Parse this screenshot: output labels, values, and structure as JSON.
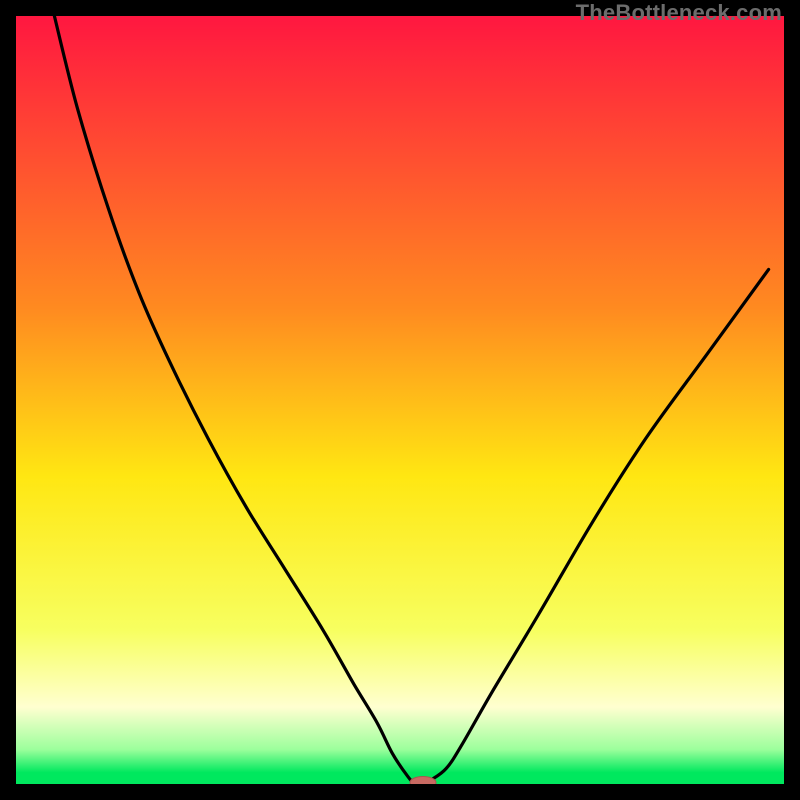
{
  "watermark": "TheBottleneck.com",
  "colors": {
    "top": "#ff1740",
    "mid_upper": "#ff8a20",
    "mid": "#ffe712",
    "mid_lower": "#f7ff60",
    "cream": "#ffffd0",
    "green_light": "#9cff9c",
    "green": "#00e85e",
    "curve": "#000000",
    "marker": "#c86a62",
    "frame": "#000000"
  },
  "chart_data": {
    "type": "line",
    "title": "",
    "xlabel": "",
    "ylabel": "",
    "xlim": [
      0,
      100
    ],
    "ylim": [
      0,
      100
    ],
    "series": [
      {
        "name": "bottleneck-curve",
        "x": [
          5,
          8,
          12,
          16,
          20,
          25,
          30,
          35,
          40,
          44,
          47,
          49,
          51,
          52,
          53,
          54,
          56,
          58,
          62,
          68,
          75,
          82,
          90,
          98
        ],
        "y": [
          100,
          88,
          75,
          64,
          55,
          45,
          36,
          28,
          20,
          13,
          8,
          4,
          1,
          0,
          0,
          0.5,
          2,
          5,
          12,
          22,
          34,
          45,
          56,
          67
        ]
      }
    ],
    "marker": {
      "x": 53,
      "y": 0.2,
      "name": "optimal-point"
    },
    "gradient_bands": [
      {
        "stop": 0.0,
        "color": "#ff1740"
      },
      {
        "stop": 0.38,
        "color": "#ff8a20"
      },
      {
        "stop": 0.6,
        "color": "#ffe712"
      },
      {
        "stop": 0.8,
        "color": "#f7ff60"
      },
      {
        "stop": 0.9,
        "color": "#ffffd0"
      },
      {
        "stop": 0.955,
        "color": "#9cff9c"
      },
      {
        "stop": 0.985,
        "color": "#00e85e"
      }
    ]
  }
}
